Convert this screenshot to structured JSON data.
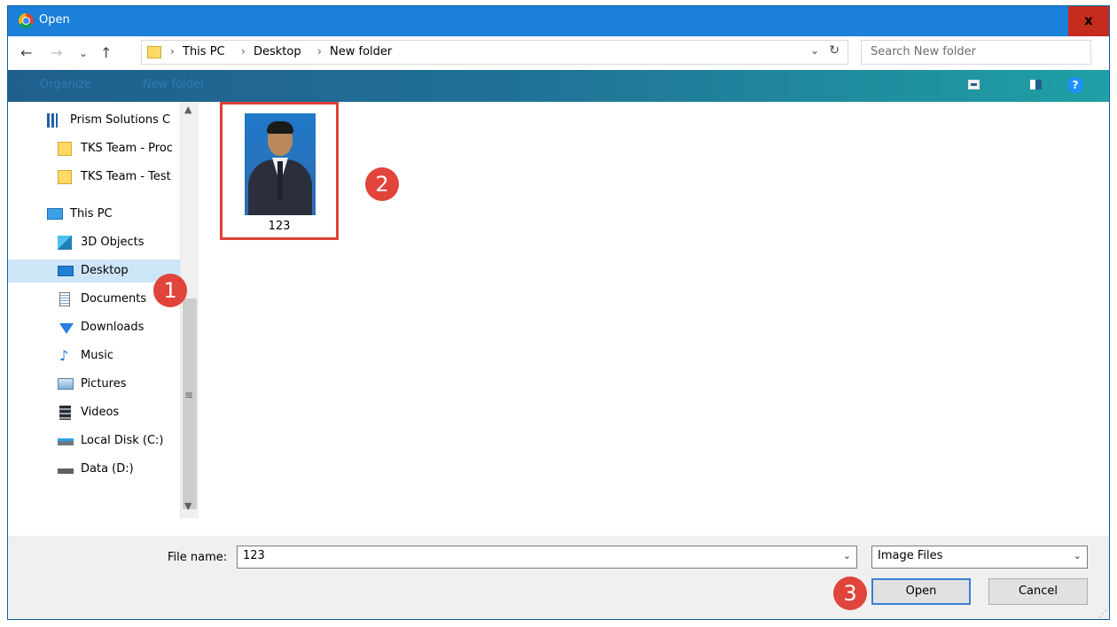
{
  "window": {
    "title": "Open",
    "close_label": "x"
  },
  "nav": {
    "back_icon": "←",
    "forward_icon": "→",
    "recent_icon": "⌄",
    "up_icon": "↑",
    "address": {
      "crumbs": [
        "This PC",
        "Desktop",
        "New folder"
      ],
      "separator": "›"
    },
    "refresh_icon": "↻",
    "dropdown_icon": "⌄",
    "search_placeholder": "Search New folder"
  },
  "command_bar": {
    "organize": "Organize",
    "new_folder": "New folder",
    "help": "?"
  },
  "sidebar": {
    "items": [
      {
        "label": "Prism Solutions C",
        "icon": "building-icon"
      },
      {
        "label": "TKS Team - Proc",
        "icon": "folder-icon"
      },
      {
        "label": "TKS Team - Test",
        "icon": "folder-icon"
      },
      {
        "label": "This PC",
        "icon": "computer-icon"
      },
      {
        "label": "3D Objects",
        "icon": "cube-icon"
      },
      {
        "label": "Desktop",
        "icon": "desktop-icon",
        "selected": true
      },
      {
        "label": "Documents",
        "icon": "documents-icon"
      },
      {
        "label": "Downloads",
        "icon": "download-icon"
      },
      {
        "label": "Music",
        "icon": "music-icon"
      },
      {
        "label": "Pictures",
        "icon": "pictures-icon"
      },
      {
        "label": "Videos",
        "icon": "videos-icon"
      },
      {
        "label": "Local Disk (C:)",
        "icon": "drive-icon"
      },
      {
        "label": "Data (D:)",
        "icon": "drive-icon"
      }
    ]
  },
  "files": [
    {
      "name": "123"
    }
  ],
  "badges": {
    "one": "1",
    "two": "2",
    "three": "3"
  },
  "bottom": {
    "file_name_label": "File name:",
    "file_name_value": "123",
    "file_type": "Image Files",
    "open_label": "Open",
    "cancel_label": "Cancel"
  },
  "colors": {
    "accent": "#1a80d9",
    "close": "#c42b1c",
    "badge": "#e0443a",
    "selection_border": "#e0403a"
  }
}
